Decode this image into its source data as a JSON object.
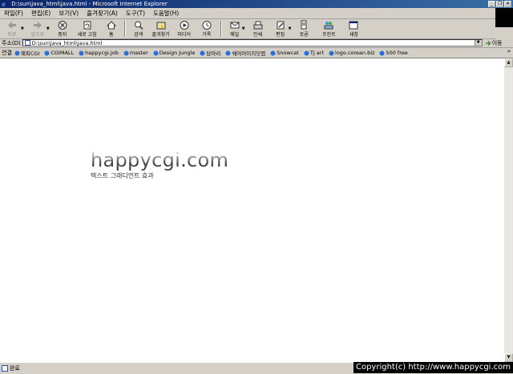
{
  "window": {
    "title": "D:\\sun\\java_html\\java.html - Microsoft Internet Explorer"
  },
  "window_buttons": [
    "_",
    "❐",
    "✕"
  ],
  "menu": [
    "파일(F)",
    "편집(E)",
    "보기(V)",
    "즐겨찾기(A)",
    "도구(T)",
    "도움말(H)"
  ],
  "toolbar": {
    "back": "뒤로",
    "forward": "앞으로",
    "stop": "중지",
    "refresh": "새로 고침",
    "home": "홈",
    "search": "검색",
    "favorites": "즐겨찾기",
    "media": "미디어",
    "history": "기록",
    "mail": "메일",
    "print": "인쇄",
    "edit": "편집",
    "discuss": "토론",
    "messenger": "프린트",
    "related": "새창"
  },
  "address": {
    "label": "주소(D)",
    "url": "D:\\sun\\java_html\\java.html",
    "go": "이동"
  },
  "links": {
    "label": "연결",
    "items": [
      "해피CGI",
      "CGIMALL",
      "happycgi.job",
      "master",
      "Design Jungle",
      "담아리",
      "쉐어어이지닷컴",
      "Snowcat",
      "TJ art",
      "logo.corean.biz",
      "500 free"
    ]
  },
  "page": {
    "title": "happycgi.com",
    "subtitle": "텍스트 그래디언트 효과"
  },
  "status": {
    "text": "완료"
  },
  "copyright": "Copyright(c) http://www.happycgi.com"
}
